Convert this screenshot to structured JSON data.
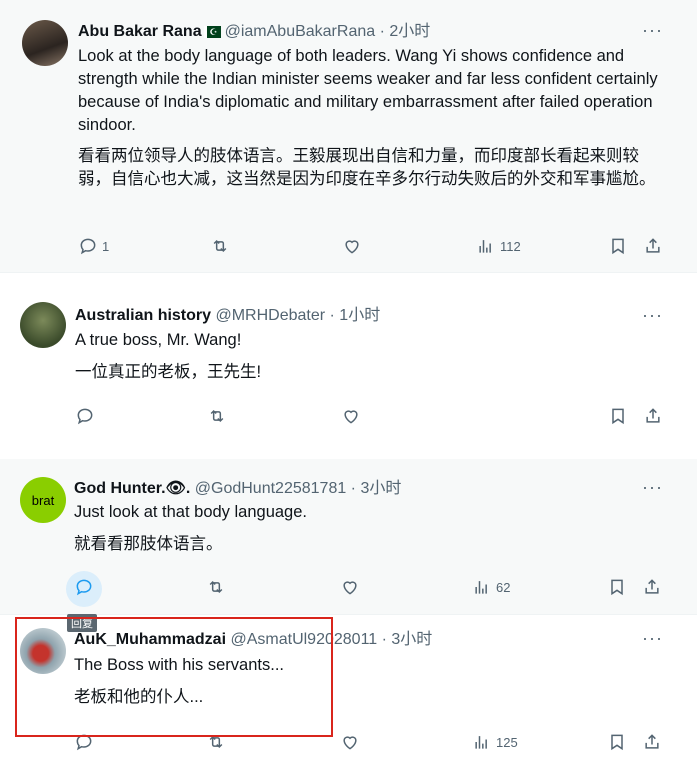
{
  "tweets": [
    {
      "name": "Abu Bakar Rana",
      "handle": "@iamAbuBakarRana · 2小时",
      "text_en": "Look at the body language of both leaders. Wang Yi shows confidence and strength while the Indian minister seems weaker and far less confident certainly because of India's diplomatic and military embarrassment after failed operation sindoor.",
      "text_zh": "看看两位领导人的肢体语言。王毅展现出自信和力量，而印度部长看起来则较弱，自信心也大减，这当然是因为印度在辛多尔行动失败后的外交和军事尴尬。",
      "replies": "1",
      "views": "112"
    },
    {
      "name": "Australian history",
      "handle": "@MRHDebater · 1小时",
      "text_en": "A true boss, Mr. Wang!",
      "text_zh": "一位真正的老板，王先生!",
      "replies": "",
      "views": ""
    },
    {
      "name": "God Hunter.👁.",
      "handle": "@GodHunt22581781 · 3小时",
      "text_en": "Just look at that body language.",
      "text_zh": "就看看那肢体语言。",
      "avatar_text": "brat",
      "replies": "",
      "views": "62"
    },
    {
      "name": "AuK_Muhammadzai",
      "handle": "@AsmatUl92028011 · 3小时",
      "text_en": "The Boss with his servants...",
      "text_zh": "老板和他的仆人...",
      "replies": "",
      "views": "125"
    }
  ],
  "tooltip": "回复",
  "more_label": "···",
  "colors": {
    "accent": "#1d9bf0",
    "muted": "#536471",
    "highlight_box": "#d9251c",
    "brat_green": "#8ace00"
  }
}
